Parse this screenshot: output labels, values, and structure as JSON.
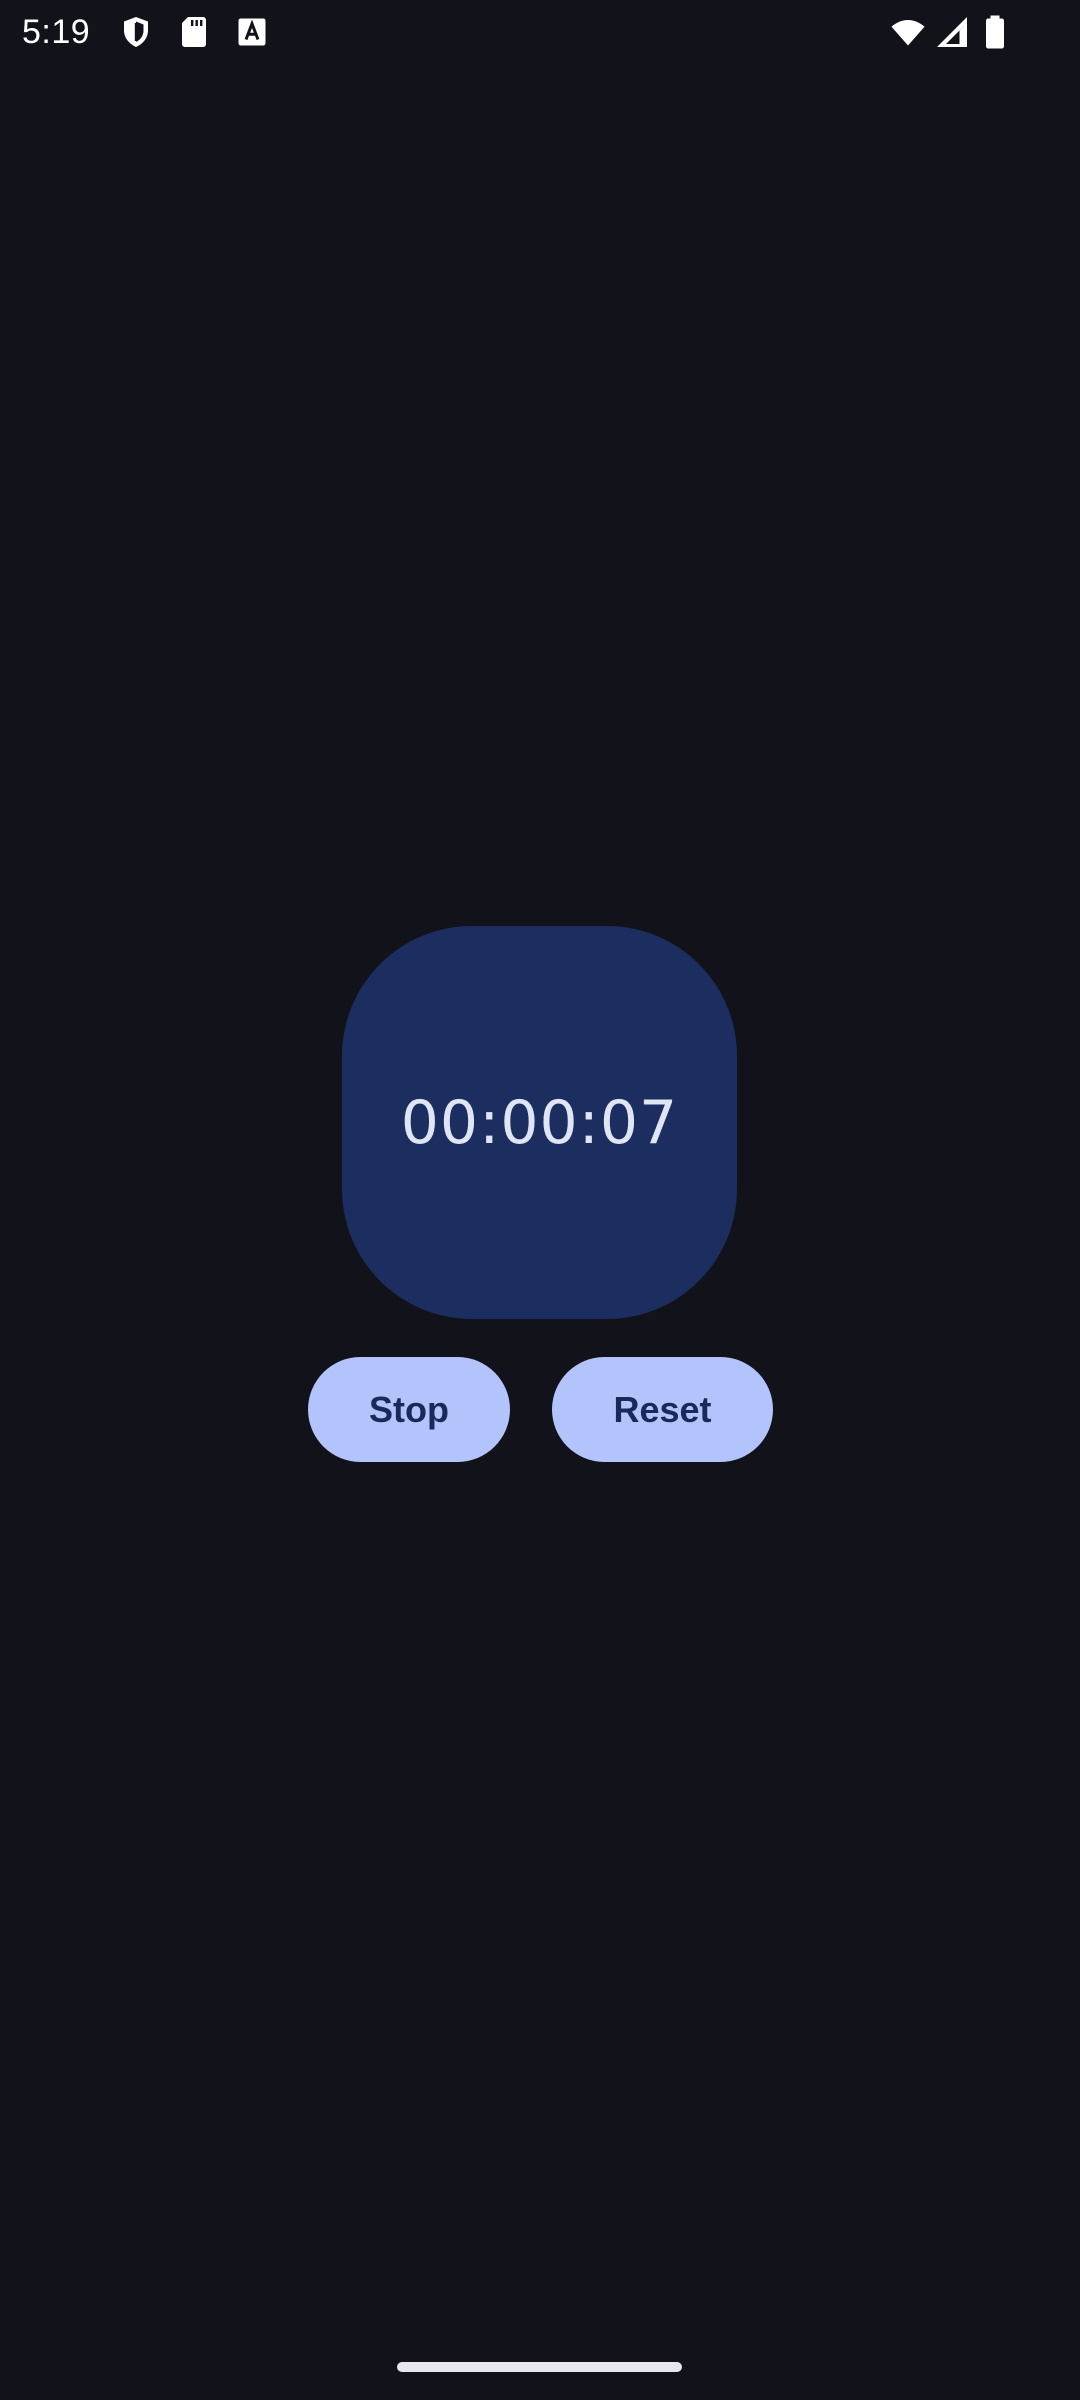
{
  "status_bar": {
    "time": "5:19",
    "left_icons": [
      "shield-icon",
      "sd-card-icon",
      "font-a-icon"
    ],
    "right_icons": [
      "wifi-icon",
      "signal-icon",
      "battery-icon"
    ]
  },
  "stopwatch": {
    "elapsed": "00:00:07"
  },
  "controls": {
    "stop_label": "Stop",
    "reset_label": "Reset"
  },
  "colors": {
    "background": "#12131a",
    "card": "#1b2e5f",
    "button": "#b3c4fd",
    "button_text": "#172a58",
    "timer_text": "#dfe5f5"
  }
}
